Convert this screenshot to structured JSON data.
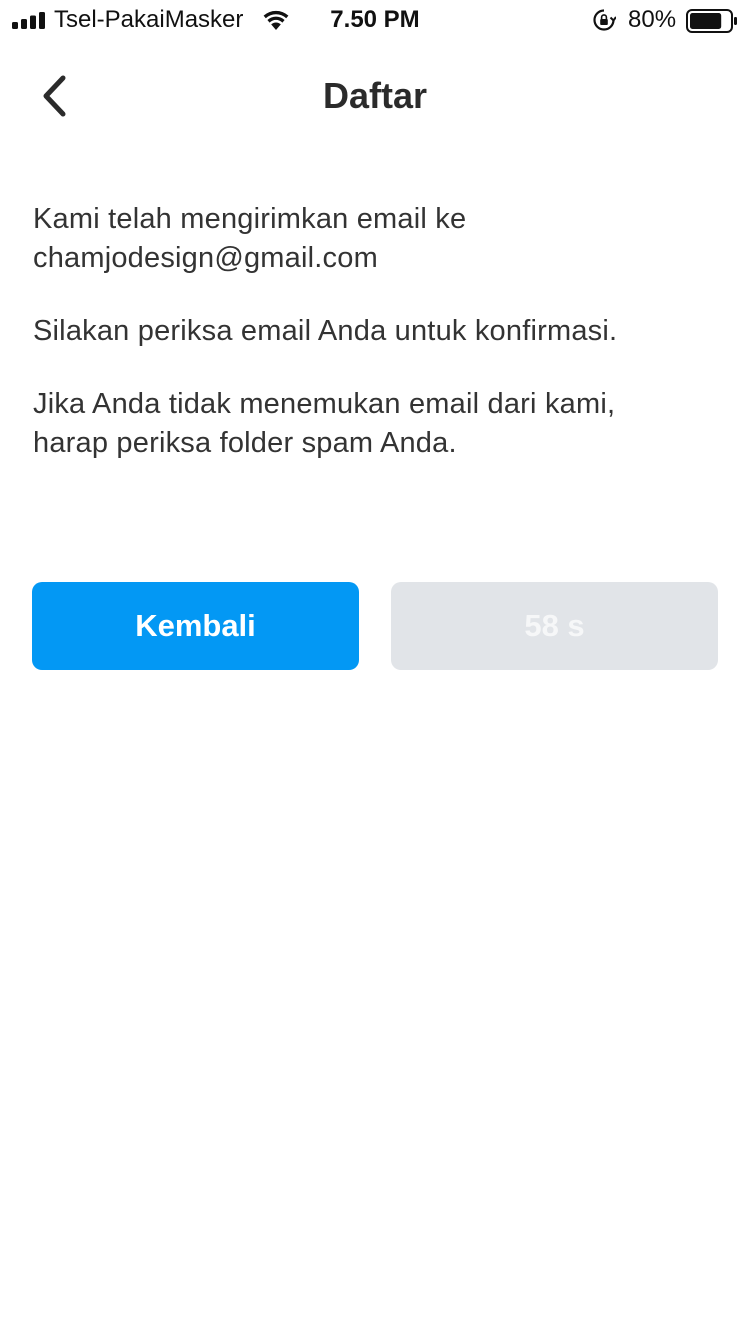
{
  "status_bar": {
    "carrier": "Tsel-PakaiMasker",
    "time": "7.50 PM",
    "battery_percent": "80%",
    "battery_level": 0.8,
    "icons": [
      "signal-icon",
      "wifi-icon",
      "orientation-lock-icon",
      "battery-icon"
    ]
  },
  "nav": {
    "back_icon": "chevron-left-icon",
    "title": "Daftar"
  },
  "content": {
    "sent_line_1": "Kami telah mengirimkan email ke",
    "sent_line_2": "chamjodesign@gmail.com",
    "check_text": "Silakan periksa email Anda untuk konfirmasi.",
    "spam_line_1": "Jika Anda tidak menemukan email dari kami,",
    "spam_line_2": "harap periksa folder spam Anda."
  },
  "actions": {
    "back_label": "Kembali",
    "resend_countdown": "58 s"
  },
  "colors": {
    "primary": "#0398f4",
    "disabled_bg": "#e1e4e8",
    "text": "#333333"
  }
}
